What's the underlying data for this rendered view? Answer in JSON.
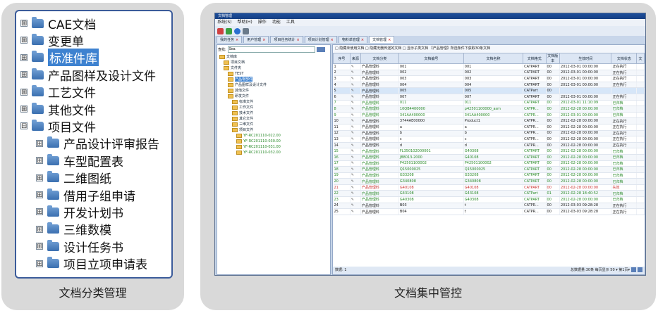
{
  "left_card": {
    "caption": "文档分类管理",
    "tree": [
      {
        "label": "CAE文档",
        "expander": "⊞",
        "indent": 0,
        "selected": false
      },
      {
        "label": "变更单",
        "expander": "⊞",
        "indent": 0,
        "selected": false
      },
      {
        "label": "标准件库",
        "expander": "⊞",
        "indent": 0,
        "selected": true
      },
      {
        "label": "产品图样及设计文件",
        "expander": "⊞",
        "indent": 0,
        "selected": false
      },
      {
        "label": "工艺文件",
        "expander": "⊞",
        "indent": 0,
        "selected": false
      },
      {
        "label": "其他文件",
        "expander": "⊞",
        "indent": 0,
        "selected": false
      },
      {
        "label": "项目文件",
        "expander": "⊟",
        "indent": 0,
        "selected": false
      },
      {
        "label": "产品设计评审报告",
        "expander": "⊞",
        "indent": 1,
        "selected": false
      },
      {
        "label": "车型配置表",
        "expander": "⊞",
        "indent": 1,
        "selected": false
      },
      {
        "label": "二维图纸",
        "expander": "⊞",
        "indent": 1,
        "selected": false
      },
      {
        "label": "借用子组申请",
        "expander": "⊞",
        "indent": 1,
        "selected": false
      },
      {
        "label": "开发计划书",
        "expander": "⊞",
        "indent": 1,
        "selected": false
      },
      {
        "label": "三维数模",
        "expander": "⊞",
        "indent": 1,
        "selected": false
      },
      {
        "label": "设计任务书",
        "expander": "⊞",
        "indent": 1,
        "selected": false
      },
      {
        "label": "项目立项申请表",
        "expander": "⊞",
        "indent": 1,
        "selected": false
      }
    ]
  },
  "right_card": {
    "caption": "文档集中管控",
    "window": {
      "title": "文档管理",
      "menu": [
        "系统(S)",
        "帮助(H)",
        "操作",
        "功能",
        "工具"
      ],
      "tabs": [
        {
          "label": "我的任务",
          "active": false
        },
        {
          "label": "用户管理",
          "active": false
        },
        {
          "label": "项目任务统计",
          "active": false
        },
        {
          "label": "项目计划管理",
          "active": false
        },
        {
          "label": "物料单管理",
          "active": false
        },
        {
          "label": "文档管理",
          "active": true
        }
      ],
      "search_label": "查找:",
      "search_value": "Sea",
      "tree": [
        {
          "label": "文档库",
          "level": 0,
          "style": ""
        },
        {
          "label": "项目文档",
          "level": 1,
          "style": ""
        },
        {
          "label": "文件夹",
          "level": 1,
          "style": ""
        },
        {
          "label": "TEST",
          "level": 2,
          "style": ""
        },
        {
          "label": "产品零部件",
          "level": 2,
          "style": "sel"
        },
        {
          "label": "产品图样及设计文件",
          "level": 2,
          "style": ""
        },
        {
          "label": "其他文件",
          "level": 2,
          "style": ""
        },
        {
          "label": "研发文件",
          "level": 2,
          "style": ""
        },
        {
          "label": "标准文件",
          "level": 3,
          "style": ""
        },
        {
          "label": "工作文件",
          "level": 3,
          "style": ""
        },
        {
          "label": "技术文件",
          "level": 3,
          "style": ""
        },
        {
          "label": "其它文件",
          "level": 3,
          "style": ""
        },
        {
          "label": "三维文件",
          "level": 3,
          "style": ""
        },
        {
          "label": "项目文件",
          "level": 3,
          "style": ""
        },
        {
          "label": "YF-RC201110-022.00",
          "level": 4,
          "style": "grn"
        },
        {
          "label": "YF-RC201110-030.00",
          "level": 4,
          "style": "grn"
        },
        {
          "label": "YF-RC201110-031.00",
          "level": 4,
          "style": "grn"
        },
        {
          "label": "YF-RC201110-032.00",
          "level": 4,
          "style": "grn"
        }
      ],
      "filter_text": "□ 隐藏未使用文档 □ 隐藏无删传送的文档 □ 显示子类文档 【产品管理】所选条件下获取30条文档",
      "columns": [
        "序号",
        "来源",
        "文档分类",
        "文档编号",
        "文档名称",
        "文档格式",
        "文档版本",
        "生效时间",
        "文档状态",
        "文"
      ],
      "rows": [
        {
          "no": "1",
          "cat": "产品管理料",
          "code": "001",
          "name": "001",
          "fmt": "CATPART",
          "ver": "00",
          "time": "2012-03-01 00:00:00",
          "status": "正在执行",
          "style": ""
        },
        {
          "no": "2",
          "cat": "产品管理料",
          "code": "002",
          "name": "002",
          "fmt": "CATPART",
          "ver": "00",
          "time": "2012-03-01 00:00:00",
          "status": "正在执行",
          "style": ""
        },
        {
          "no": "3",
          "cat": "产品管理料",
          "code": "003",
          "name": "003",
          "fmt": "CATPART",
          "ver": "00",
          "time": "2012-03-01 00:00:00",
          "status": "正在执行",
          "style": ""
        },
        {
          "no": "4",
          "cat": "产品管理料",
          "code": "004",
          "name": "004",
          "fmt": "CATPART",
          "ver": "00",
          "time": "2012-03-01 00:00:00",
          "status": "正在执行",
          "style": ""
        },
        {
          "no": "5",
          "cat": "产品管理料",
          "code": "005",
          "name": "005",
          "fmt": "CATPart",
          "ver": "00",
          "time": "",
          "status": "",
          "style": "hl"
        },
        {
          "no": "6",
          "cat": "产品管理料",
          "code": "007",
          "name": "007",
          "fmt": "CATPART",
          "ver": "00",
          "time": "2012-03-01 00:00:00",
          "status": "正在执行",
          "style": ""
        },
        {
          "no": "7",
          "cat": "产品管理料",
          "code": "011",
          "name": "011",
          "fmt": "CATPART",
          "ver": "00",
          "time": "2012-03-01 11:10:09",
          "status": "已归档",
          "style": "green"
        },
        {
          "no": "8",
          "cat": "产品管理料",
          "code": "10QB4400000",
          "name": "p42501100000_asm",
          "fmt": "CATPR...",
          "ver": "00",
          "time": "2012-02-28 00:00:00",
          "status": "已归档",
          "style": "green"
        },
        {
          "no": "9",
          "cat": "产品管理料",
          "code": "341AA400000",
          "name": "341AA400000",
          "fmt": "CATPR...",
          "ver": "00",
          "time": "2012-03-01 00:00:00",
          "status": "已归档",
          "style": "green"
        },
        {
          "no": "10",
          "cat": "产品管理料",
          "code": "3744AE00000",
          "name": "Product1",
          "fmt": "CATPR...",
          "ver": "00",
          "time": "2012-02-28 00:00:00",
          "status": "正在执行",
          "style": ""
        },
        {
          "no": "11",
          "cat": "产品管理料",
          "code": "a",
          "name": "a",
          "fmt": "CATPR...",
          "ver": "00",
          "time": "2012-02-28 00:00:00",
          "status": "正在执行",
          "style": ""
        },
        {
          "no": "12",
          "cat": "产品管理料",
          "code": "b",
          "name": "b",
          "fmt": "CATPR...",
          "ver": "00",
          "time": "2012-02-28 00:00:00",
          "status": "正在执行",
          "style": ""
        },
        {
          "no": "13",
          "cat": "产品管理料",
          "code": "c",
          "name": "c",
          "fmt": "CATPR...",
          "ver": "00",
          "time": "2012-02-28 00:00:00",
          "status": "正在执行",
          "style": ""
        },
        {
          "no": "14",
          "cat": "产品管理料",
          "code": "d",
          "name": "d",
          "fmt": "CATPR...",
          "ver": "00",
          "time": "2012-02-28 00:00:00",
          "status": "正在执行",
          "style": ""
        },
        {
          "no": "15",
          "cat": "产品管理料",
          "code": "FL350102000001",
          "name": "G40308",
          "fmt": "CATPART",
          "ver": "00",
          "time": "2012-02-28 00:00:00",
          "status": "已归档",
          "style": "green"
        },
        {
          "no": "16",
          "cat": "产品管理料",
          "code": "J88013-2000",
          "name": "G40108",
          "fmt": "CATPART",
          "ver": "00",
          "time": "2012-02-28 00:00:00",
          "status": "已归档",
          "style": "green"
        },
        {
          "no": "17",
          "cat": "产品管理料",
          "code": "P42501100002",
          "name": "P42501100002",
          "fmt": "CATPART",
          "ver": "00",
          "time": "2012-02-28 00:00:00",
          "status": "已归档",
          "style": "green"
        },
        {
          "no": "18",
          "cat": "产品管理料",
          "code": "Q15000025",
          "name": "Q15000025",
          "fmt": "CATPART",
          "ver": "00",
          "time": "2012-02-28 00:00:00",
          "status": "已归档",
          "style": "green"
        },
        {
          "no": "19",
          "cat": "产品管理料",
          "code": "G33208",
          "name": "G33208",
          "fmt": "CATPART",
          "ver": "00",
          "time": "2012-02-28 00:00:00",
          "status": "已归档",
          "style": "green"
        },
        {
          "no": "20",
          "cat": "产品管理料",
          "code": "G340808",
          "name": "G340808",
          "fmt": "CATPART",
          "ver": "00",
          "time": "2012-02-28 00:00:00",
          "status": "已归档",
          "style": "green"
        },
        {
          "no": "21",
          "cat": "产品管理料",
          "code": "G40108",
          "name": "G40108",
          "fmt": "CATPART",
          "ver": "00",
          "time": "2012-02-28 00:00:00",
          "status": "失效",
          "style": "red"
        },
        {
          "no": "22",
          "cat": "产品管理料",
          "code": "G43108",
          "name": "G43108",
          "fmt": "CATPart",
          "ver": "01",
          "time": "2012-02-28 18:40:52",
          "status": "已归档",
          "style": "green"
        },
        {
          "no": "23",
          "cat": "产品管理料",
          "code": "G40308",
          "name": "G40308",
          "fmt": "CATPART",
          "ver": "00",
          "time": "2012-02-28 00:00:00",
          "status": "已归档",
          "style": "green"
        },
        {
          "no": "24",
          "cat": "产品管理料",
          "code": "B03",
          "name": "t",
          "fmt": "CATPR...",
          "ver": "00",
          "time": "2012-03-03 09:28:28",
          "status": "正在执行",
          "style": ""
        },
        {
          "no": "25",
          "cat": "产品管理料",
          "code": "B04",
          "name": "t",
          "fmt": "CATPR...",
          "ver": "00",
          "time": "2012-03-03 09:28:28",
          "status": "正在执行",
          "style": ""
        }
      ],
      "status_left": "数据: 1",
      "status_right": "总数据量:30条  每页显示 50 ▾  第1页▾"
    }
  }
}
